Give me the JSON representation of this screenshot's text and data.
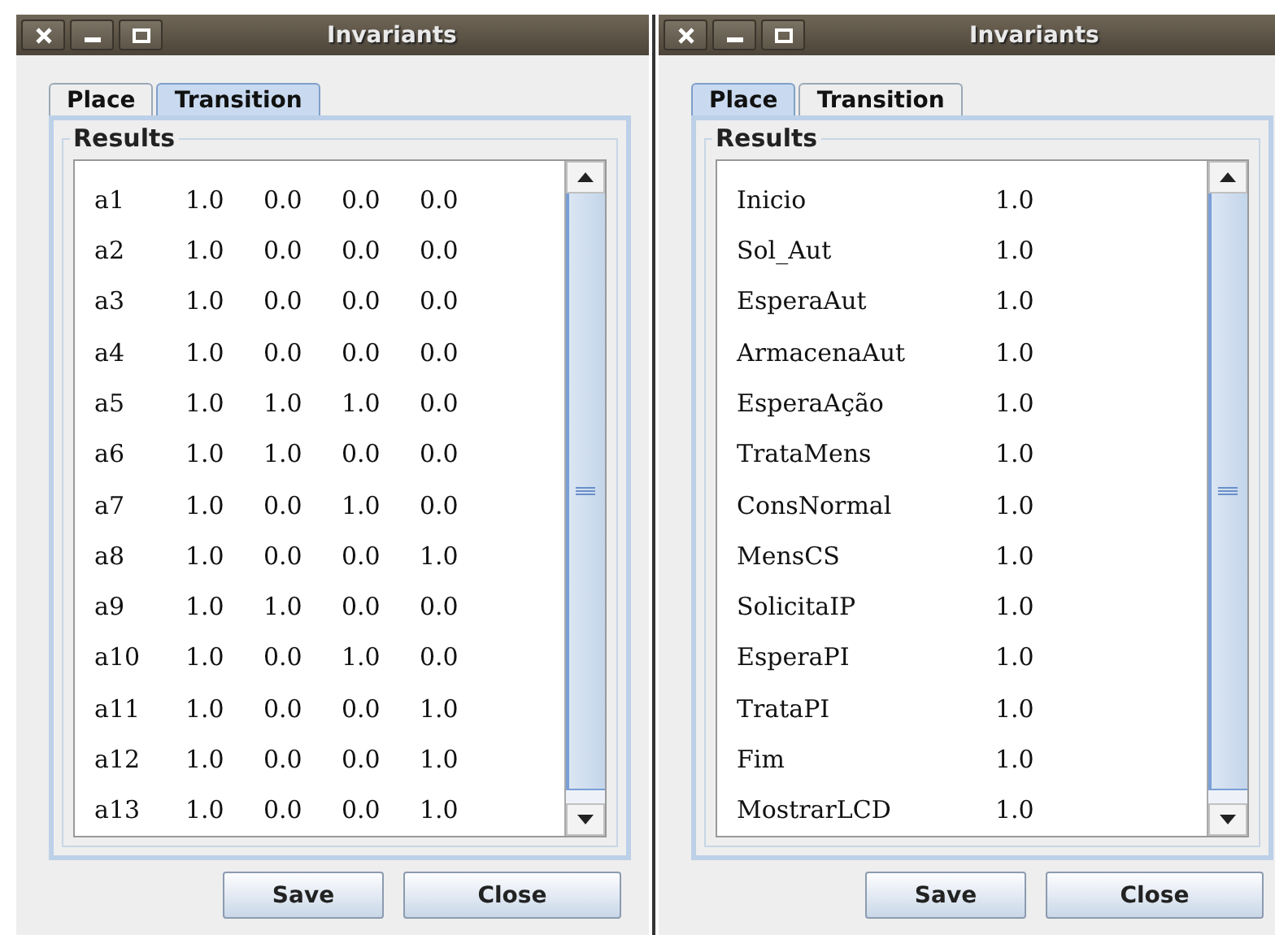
{
  "windows": [
    {
      "title": "Invariants",
      "tabs": [
        {
          "label": "Place",
          "selected": false
        },
        {
          "label": "Transition",
          "selected": true
        }
      ],
      "group_title": "Results",
      "rows": [
        {
          "cells": [
            "a1",
            "1.0",
            "0.0",
            "0.0",
            "0.0"
          ]
        },
        {
          "cells": [
            "a2",
            "1.0",
            "0.0",
            "0.0",
            "0.0"
          ]
        },
        {
          "cells": [
            "a3",
            "1.0",
            "0.0",
            "0.0",
            "0.0"
          ]
        },
        {
          "cells": [
            "a4",
            "1.0",
            "0.0",
            "0.0",
            "0.0"
          ]
        },
        {
          "cells": [
            "a5",
            "1.0",
            "1.0",
            "1.0",
            "0.0"
          ]
        },
        {
          "cells": [
            "a6",
            "1.0",
            "1.0",
            "0.0",
            "0.0"
          ]
        },
        {
          "cells": [
            "a7",
            "1.0",
            "0.0",
            "1.0",
            "0.0"
          ]
        },
        {
          "cells": [
            "a8",
            "1.0",
            "0.0",
            "0.0",
            "1.0"
          ]
        },
        {
          "cells": [
            "a9",
            "1.0",
            "1.0",
            "0.0",
            "0.0"
          ]
        },
        {
          "cells": [
            "a10",
            "1.0",
            "0.0",
            "1.0",
            "0.0"
          ]
        },
        {
          "cells": [
            "a11",
            "1.0",
            "0.0",
            "0.0",
            "1.0"
          ]
        },
        {
          "cells": [
            "a12",
            "1.0",
            "0.0",
            "0.0",
            "1.0"
          ]
        },
        {
          "cells": [
            "a13",
            "1.0",
            "0.0",
            "0.0",
            "1.0"
          ]
        }
      ],
      "buttons": [
        "Save",
        "Close"
      ]
    },
    {
      "title": "Invariants",
      "tabs": [
        {
          "label": "Place",
          "selected": true
        },
        {
          "label": "Transition",
          "selected": false
        }
      ],
      "group_title": "Results",
      "rows": [
        {
          "cells": [
            "Inicio",
            "1.0"
          ]
        },
        {
          "cells": [
            "Sol_Aut",
            "1.0"
          ]
        },
        {
          "cells": [
            "EsperaAut",
            "1.0"
          ]
        },
        {
          "cells": [
            "ArmacenaAut",
            "1.0"
          ]
        },
        {
          "cells": [
            "EsperaAção",
            "1.0"
          ]
        },
        {
          "cells": [
            "TrataMens",
            "1.0"
          ]
        },
        {
          "cells": [
            "ConsNormal",
            "1.0"
          ]
        },
        {
          "cells": [
            "MensCS",
            "1.0"
          ]
        },
        {
          "cells": [
            "SolicitaIP",
            "1.0"
          ]
        },
        {
          "cells": [
            "EsperaPI",
            "1.0"
          ]
        },
        {
          "cells": [
            "TrataPI",
            "1.0"
          ]
        },
        {
          "cells": [
            "Fim",
            "1.0"
          ]
        },
        {
          "cells": [
            "MostrarLCD",
            "1.0"
          ]
        }
      ],
      "buttons": [
        "Save",
        "Close"
      ]
    }
  ]
}
